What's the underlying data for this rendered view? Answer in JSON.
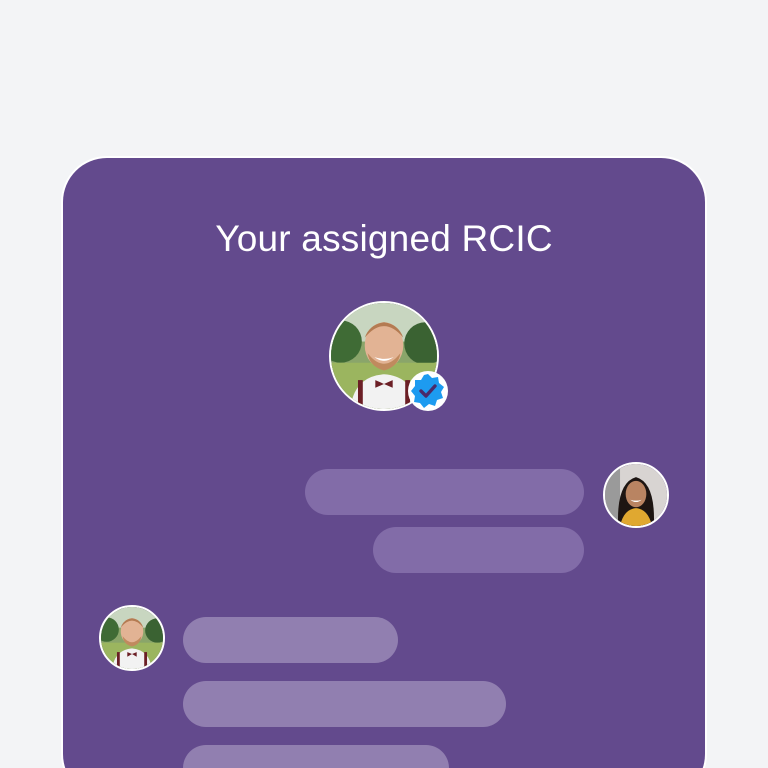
{
  "card": {
    "title": "Your assigned RCIC",
    "background_color": "#634a8d"
  },
  "avatars": {
    "rcic": {
      "icon": "rcic-avatar",
      "verified_icon": "verified-badge-icon",
      "badge_color": "#1d9bf0"
    },
    "user": {
      "icon": "user-avatar"
    }
  },
  "messages": [
    {
      "side": "outgoing",
      "placeholder": true
    },
    {
      "side": "outgoing",
      "placeholder": true
    },
    {
      "side": "incoming",
      "placeholder": true
    },
    {
      "side": "incoming",
      "placeholder": true
    },
    {
      "side": "incoming",
      "placeholder": true
    }
  ],
  "colors": {
    "page_background": "#f3f4f6",
    "outgoing_bubble": "#826ca8",
    "incoming_bubble": "#917fb0"
  }
}
